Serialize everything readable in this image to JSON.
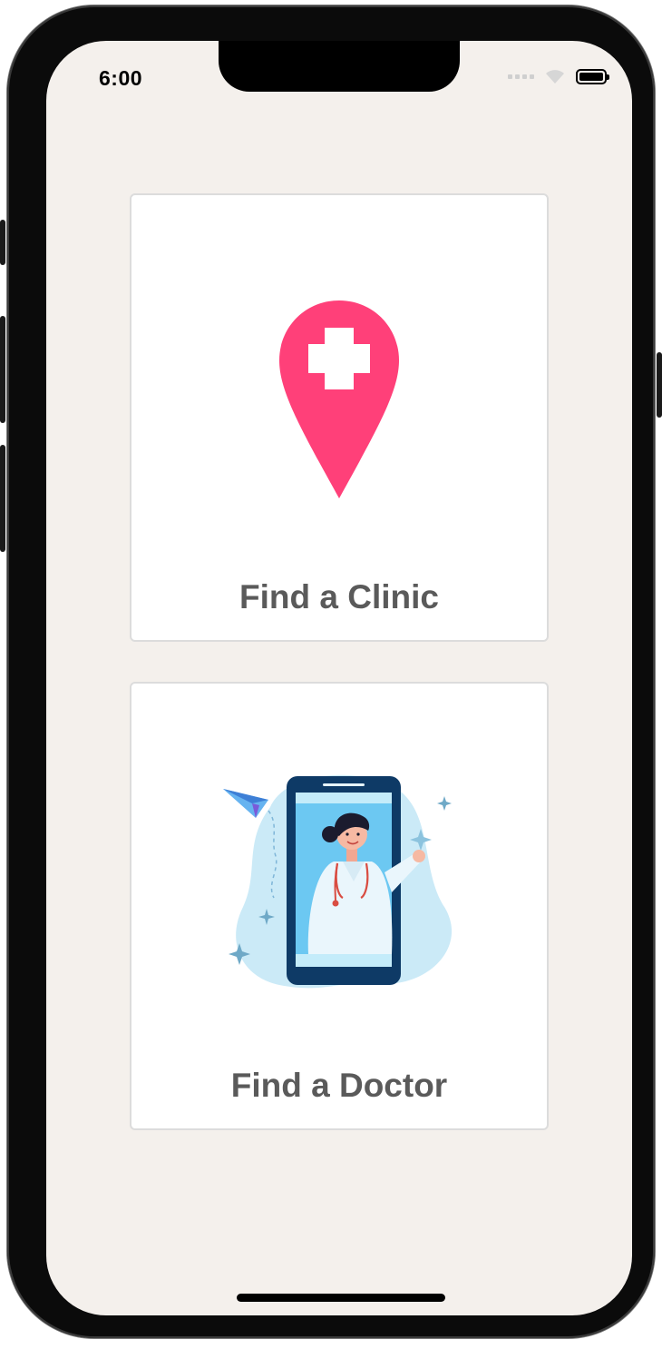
{
  "status_bar": {
    "time": "6:00"
  },
  "cards": {
    "clinic": {
      "label": "Find a Clinic",
      "icon": "map-pin-medical-cross-icon"
    },
    "doctor": {
      "label": "Find a Doctor",
      "illustration": "doctor-on-phone-illustration"
    }
  },
  "colors": {
    "background": "#f4f0ec",
    "card": "#ffffff",
    "pin": "#ff4079",
    "label": "#5a5a5a",
    "phone": "#0e3a66",
    "phone_screen": "#6cc8f2"
  }
}
